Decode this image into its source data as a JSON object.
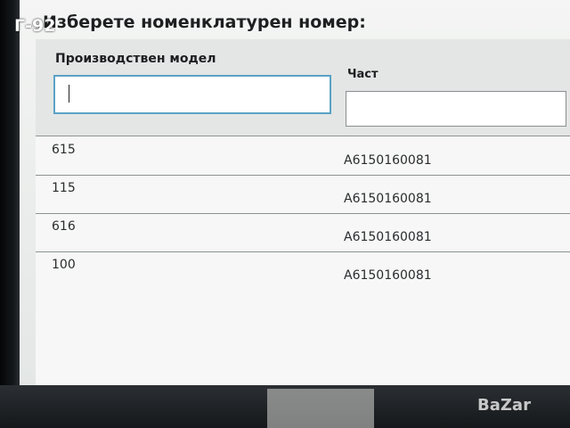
{
  "overlay_tag": "Г-92",
  "dialog": {
    "title": "Изберете номенклатурен номер:"
  },
  "filters": {
    "model_label": "Производствен модел",
    "model_value": "",
    "part_label": "Част",
    "part_value": ""
  },
  "table": {
    "rows": [
      {
        "model": "615",
        "part": "A6150160081"
      },
      {
        "model": "115",
        "part": "A6150160081"
      },
      {
        "model": "616",
        "part": "A6150160081"
      },
      {
        "model": "100",
        "part": "A6150160081"
      }
    ]
  },
  "watermark": "BaZar"
}
